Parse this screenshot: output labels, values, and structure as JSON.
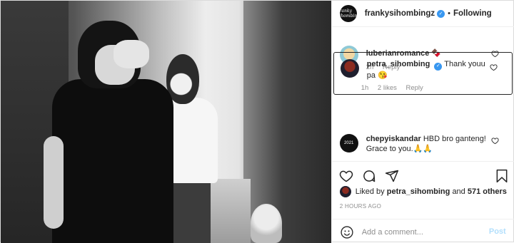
{
  "header": {
    "avatar_text": "Franky Sihombing",
    "username": "frankysihombingz",
    "separator": "•",
    "follow_status": "Following"
  },
  "comments": [
    {
      "username": "luberianromance",
      "text": "🍫",
      "time": "2h",
      "reply": "Reply"
    },
    {
      "username": "petra_sihombing",
      "verified": true,
      "text": "Thank youu pa 😘",
      "time": "1h",
      "likes": "2 likes",
      "reply": "Reply"
    },
    {
      "username": "chepyiskandar",
      "avatar_text": "2021",
      "text": "HBD bro ganteng! Grace to you.🙏🙏"
    }
  ],
  "icons": {
    "like": "heart-icon",
    "comment": "comment-icon",
    "share": "share-icon",
    "save": "bookmark-icon",
    "emoji": "emoji-icon"
  },
  "likes": {
    "prefix": "Liked by",
    "user": "petra_sihombing",
    "conjunction": "and",
    "others": "571 others"
  },
  "timeago": "2 HOURS AGO",
  "add_comment": {
    "placeholder": "Add a comment...",
    "post_label": "Post"
  },
  "colors": {
    "verified": "#3897f0",
    "muted": "#8e8e8e",
    "post_disabled": "#b2dffc"
  }
}
